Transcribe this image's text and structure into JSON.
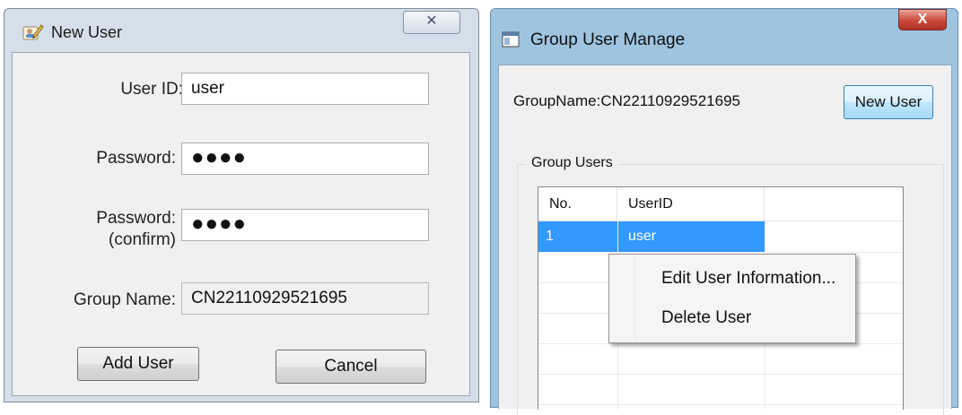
{
  "new_user_window": {
    "title": "New User",
    "close_glyph": "✕",
    "fields": {
      "user_id": {
        "label": "User ID:",
        "value": "user"
      },
      "password": {
        "label": "Password:",
        "value": "●●●●"
      },
      "password_confirm": {
        "label_line1": "Password:",
        "label_line2": "(confirm)",
        "value": "●●●●"
      },
      "group_name": {
        "label": "Group Name:",
        "value": "CN22110929521695"
      }
    },
    "buttons": {
      "add_user": "Add User",
      "cancel": "Cancel"
    }
  },
  "group_window": {
    "title": "Group User Manage",
    "close_glyph": "X",
    "group_name_text": "GroupName:CN22110929521695",
    "new_user_button": "New User",
    "group_box_label": "Group Users",
    "table": {
      "columns": [
        "No.",
        "UserID"
      ],
      "rows": [
        {
          "no": "1",
          "user_id": "user"
        }
      ]
    },
    "context_menu": {
      "items": [
        "Edit User Information...",
        "Delete User"
      ]
    }
  },
  "colors": {
    "selection": "#3399ff",
    "group_titlebar": "#9ec4e0",
    "new_user_titlebar": "#d5dfea",
    "close_red": "#c7483a"
  }
}
